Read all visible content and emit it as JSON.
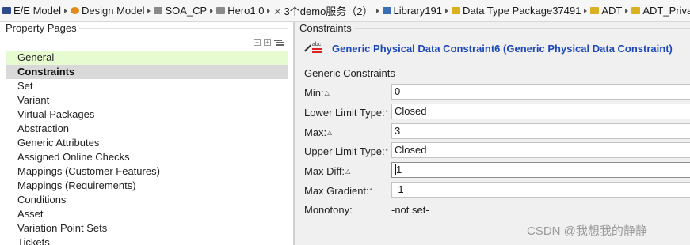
{
  "breadcrumb": [
    {
      "icon": "model-icon",
      "label": "E/E Model"
    },
    {
      "icon": "design-model-icon",
      "label": "Design Model"
    },
    {
      "icon": "folder-icon",
      "label": "SOA_CP"
    },
    {
      "icon": "folder-icon",
      "label": "Hero1.0"
    },
    {
      "icon": "component-icon",
      "label": "3个demo服务（2）"
    },
    {
      "icon": "library-icon",
      "label": "Library191"
    },
    {
      "icon": "package-icon",
      "label": "Data Type Package37491"
    },
    {
      "icon": "package-icon",
      "label": "ADT"
    },
    {
      "icon": "package-icon",
      "label": "ADT_Private"
    }
  ],
  "left_pane": {
    "title": "Property Pages",
    "items": [
      {
        "label": "General",
        "state": "highlighted"
      },
      {
        "label": "Constraints",
        "state": "selected"
      },
      {
        "label": "Set",
        "state": ""
      },
      {
        "label": "Variant",
        "state": ""
      },
      {
        "label": "Virtual Packages",
        "state": ""
      },
      {
        "label": "Abstraction",
        "state": ""
      },
      {
        "label": "Generic Attributes",
        "state": ""
      },
      {
        "label": "Assigned Online Checks",
        "state": ""
      },
      {
        "label": "Mappings (Customer Features)",
        "state": ""
      },
      {
        "label": "Mappings (Requirements)",
        "state": ""
      },
      {
        "label": "Conditions",
        "state": ""
      },
      {
        "label": "Asset",
        "state": ""
      },
      {
        "label": "Variation Point Sets",
        "state": ""
      },
      {
        "label": "Tickets",
        "state": ""
      }
    ]
  },
  "right_pane": {
    "title": "Constraints",
    "header": "Generic Physical Data Constraint6 (Generic Physical Data Constraint)",
    "group_title": "Generic Constraints",
    "fields": [
      {
        "label": "Min:",
        "mark": "△",
        "value": "0",
        "kind": "input"
      },
      {
        "label": "Lower Limit Type:",
        "mark": "*",
        "value": "Closed",
        "kind": "input"
      },
      {
        "label": "Max:",
        "mark": "△",
        "value": "3",
        "kind": "input"
      },
      {
        "label": "Upper Limit Type:",
        "mark": "*",
        "value": "Closed",
        "kind": "input"
      },
      {
        "label": "Max Diff:",
        "mark": "△",
        "value": "1",
        "kind": "input-focused"
      },
      {
        "label": "Max Gradient:",
        "mark": "*",
        "value": "-1",
        "kind": "input"
      },
      {
        "label": "Monotony:",
        "mark": "",
        "value": "-not set-",
        "kind": "plain"
      }
    ]
  },
  "watermark": "CSDN @我想我的静静",
  "colors": {
    "highlight": "#e6fbd0",
    "selected": "#d9d9d9",
    "header_blue": "#1c47b8"
  }
}
